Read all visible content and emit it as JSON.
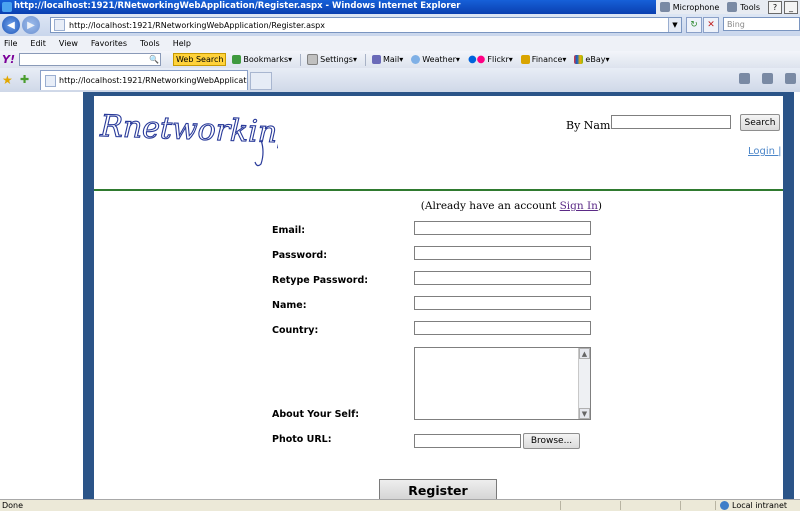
{
  "window": {
    "title": "http://localhost:1921/RNetworkingWebApplication/Register.aspx - Windows Internet Explorer",
    "microphone_label": "Microphone",
    "tools_label": "Tools",
    "help_symbol": "?"
  },
  "address_bar": {
    "url": "http://localhost:1921/RNetworkingWebApplication/Register.aspx",
    "search_placeholder": "Bing"
  },
  "menu": {
    "items": [
      "File",
      "Edit",
      "View",
      "Favorites",
      "Tools",
      "Help"
    ]
  },
  "yahoo_toolbar": {
    "logo": "Y!",
    "web_search_label": "Web Search",
    "items": [
      "Bookmarks",
      "Settings",
      "Mail",
      "Weather",
      "Flickr",
      "Finance",
      "eBay"
    ]
  },
  "tab": {
    "title": "http://localhost:1921/RNetworkingWebApplication/Re..."
  },
  "page": {
    "logo_text": "Rnetworking",
    "by_name_label": "By Name:",
    "search_button": "Search",
    "login_link": "Login |",
    "already_prefix": "(Already have an account ",
    "sign_in_link": "Sign In",
    "already_suffix": ")",
    "form": {
      "email_label": "Email:",
      "password_label": "Password:",
      "retype_label": "Retype Password:",
      "name_label": "Name:",
      "country_label": "Country:",
      "about_label": "About Your Self:",
      "photo_label": "Photo URL:",
      "browse_button": "Browse...",
      "register_button": "Register"
    }
  },
  "status": {
    "left": "Done",
    "zone": "Local intranet"
  },
  "colors": {
    "frame": "#2b5488",
    "rule": "#2f7a2f",
    "login_link": "#4c86c9",
    "sign_in_link": "#5b2a86"
  }
}
